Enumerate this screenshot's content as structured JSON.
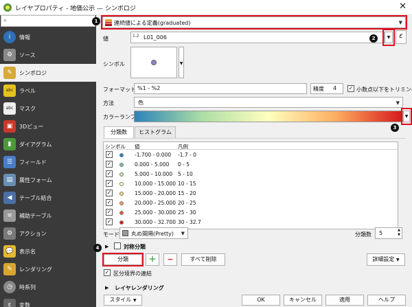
{
  "window": {
    "title": "レイヤプロパティ - 地価公示 — シンボロジ"
  },
  "sidebar": {
    "search_placeholder": "",
    "items": [
      {
        "label": "情報",
        "icon": "info-icon"
      },
      {
        "label": "ソース",
        "icon": "source-icon"
      },
      {
        "label": "シンボロジ",
        "icon": "paintbrush-icon"
      },
      {
        "label": "ラベル",
        "icon": "label-icon"
      },
      {
        "label": "マスク",
        "icon": "mask-icon"
      },
      {
        "label": "3Dビュー",
        "icon": "cube-icon"
      },
      {
        "label": "ダイアグラム",
        "icon": "diagram-icon"
      },
      {
        "label": "フィールド",
        "icon": "field-icon"
      },
      {
        "label": "属性フォーム",
        "icon": "form-icon"
      },
      {
        "label": "テーブル結合",
        "icon": "join-icon"
      },
      {
        "label": "補助テーブル",
        "icon": "auxiliary-icon"
      },
      {
        "label": "アクション",
        "icon": "action-icon"
      },
      {
        "label": "表示名",
        "icon": "display-icon"
      },
      {
        "label": "レンダリング",
        "icon": "rendering-icon"
      },
      {
        "label": "時系列",
        "icon": "clock-icon"
      },
      {
        "label": "変数",
        "icon": "variable-icon"
      }
    ]
  },
  "renderer": {
    "label": "連続値による定義(graduated)"
  },
  "value": {
    "label": "値",
    "type_badge": "1.2",
    "field": "L01_006"
  },
  "symbol": {
    "label": "シンボル"
  },
  "format": {
    "label": "フォーマット",
    "value": "%1 - %2",
    "precision_label": "精度",
    "precision_value": "4",
    "trim_label": "小数点以下をトリミング",
    "trim_checked": true
  },
  "method": {
    "label": "方法",
    "value": "色"
  },
  "color_ramp": {
    "label": "カラーランプ"
  },
  "tabs": [
    {
      "label": "分類数"
    },
    {
      "label": "ヒストグラム"
    }
  ],
  "table": {
    "headers": {
      "symbol": "シンボル",
      "value": "値",
      "legend": "凡例"
    },
    "rows": [
      {
        "value": "-1.700 - 0.000",
        "legend": "-1.7 - 0",
        "color": "#2b83ba"
      },
      {
        "value": "0.000 - 5.000",
        "legend": "0 - 5",
        "color": "#80bfab"
      },
      {
        "value": "5.000 - 10.000",
        "legend": "5 - 10",
        "color": "#c7e8ad"
      },
      {
        "value": "10.000 - 15.000",
        "legend": "10 - 15",
        "color": "#ffffbf"
      },
      {
        "value": "15.000 - 20.000",
        "legend": "15 - 20",
        "color": "#fdd38d"
      },
      {
        "value": "20.000 - 25.000",
        "legend": "20 - 25",
        "color": "#f99d59"
      },
      {
        "value": "25.000 - 30.000",
        "legend": "25 - 30",
        "color": "#e85b3a"
      },
      {
        "value": "30.000 - 32.700",
        "legend": "30 - 32.7",
        "color": "#d7191c"
      }
    ]
  },
  "mode": {
    "label": "モード",
    "value": "丸め間隔(Pretty)"
  },
  "classes": {
    "label": "分類数",
    "value": "5"
  },
  "symmetric": {
    "label": "対称分類"
  },
  "buttons": {
    "classify": "分類",
    "delete_all": "すべて削除",
    "advanced": "詳細設定",
    "style": "スタイル",
    "ok": "OK",
    "cancel": "キャンセル",
    "apply": "適用",
    "help": "ヘルプ"
  },
  "link_boundaries": {
    "label": "区分境界の連結",
    "checked": true
  },
  "layer_rendering": {
    "label": "レイヤレンダリング"
  },
  "annotations": [
    "1",
    "2",
    "3",
    "4"
  ],
  "colors": {
    "highlight": "#e01020",
    "sidebar_bg": "#3a3a3a"
  }
}
